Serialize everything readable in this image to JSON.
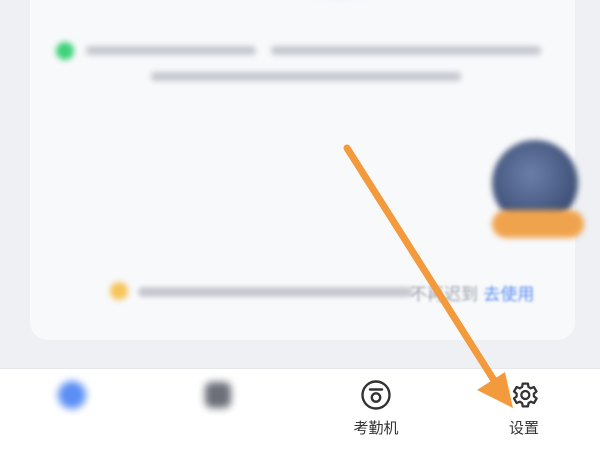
{
  "promo": {
    "text_plain": "不再迟到",
    "link_label": "去使用"
  },
  "tabbar": {
    "tabs": [
      {
        "label": "",
        "icon": "home-icon",
        "active": true
      },
      {
        "label": "",
        "icon": "app-icon",
        "active": false
      },
      {
        "label": "考勤机",
        "icon": "attendance-machine-icon",
        "active": false
      },
      {
        "label": "设置",
        "icon": "gear-icon",
        "active": false
      }
    ]
  },
  "colors": {
    "accent_blue": "#5b8ff5",
    "arrow_orange": "#f39a3c",
    "status_green": "#3fd27a",
    "badge_orange": "#f0a34d"
  }
}
